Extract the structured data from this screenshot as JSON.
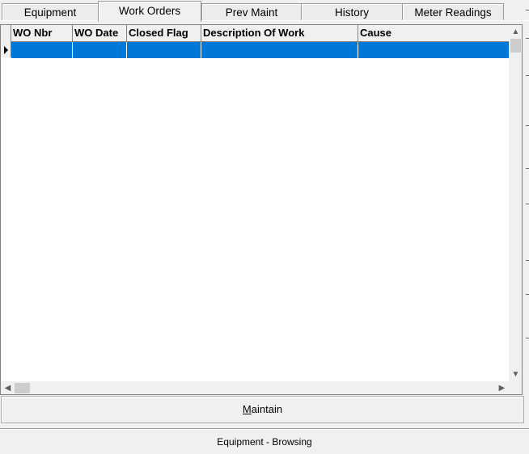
{
  "tabs": [
    {
      "label": "Equipment",
      "active": false
    },
    {
      "label": "Work Orders",
      "active": true
    },
    {
      "label": "Prev Maint",
      "active": false
    },
    {
      "label": "History",
      "active": false
    },
    {
      "label": "Meter Readings",
      "active": false
    }
  ],
  "grid": {
    "columns": [
      "WO Nbr",
      "WO Date",
      "Closed Flag",
      "Description Of Work",
      "Cause"
    ],
    "rows": [
      {
        "cells": [
          "",
          "",
          "",
          "",
          ""
        ],
        "selected": true
      }
    ]
  },
  "scroll_icons": {
    "up": "▲",
    "down": "▼",
    "left": "◀",
    "right": "▶"
  },
  "maintain_button": {
    "accel": "M",
    "rest": "aintain"
  },
  "status_bar": {
    "text": "Equipment - Browsing"
  },
  "colors": {
    "selection": "#0078d7",
    "background": "#f0f0f0"
  }
}
